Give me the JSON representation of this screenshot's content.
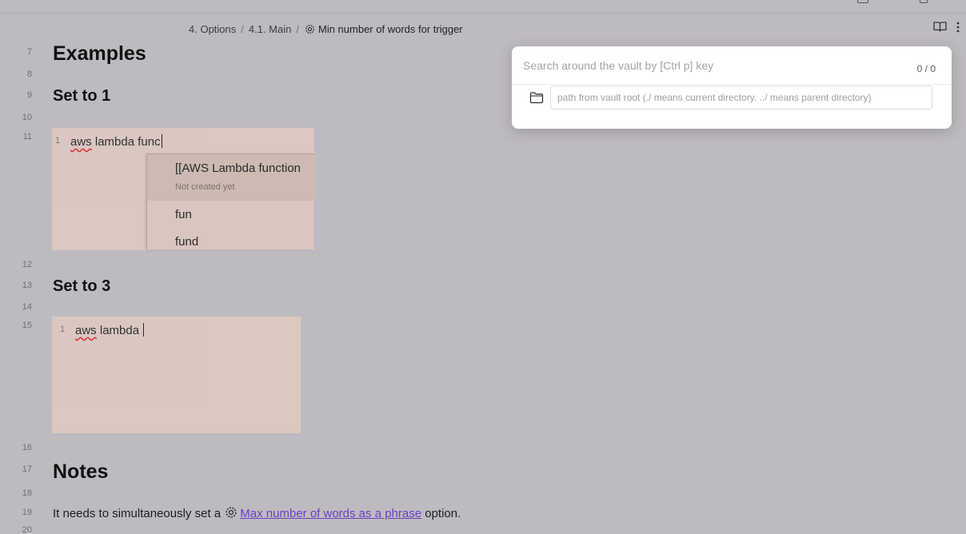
{
  "breadcrumb": {
    "items": [
      "4. Options",
      "4.1. Main"
    ],
    "current": "Min number of words for trigger",
    "separator": "/"
  },
  "view_actions": {
    "reading_view_icon": "book-open-icon",
    "more_options_icon": "more-vertical-icon"
  },
  "editor": {
    "line_numbers": {
      "l7": "7",
      "l8": "8",
      "l9": "9",
      "l10": "10",
      "l11": "11",
      "l12": "12",
      "l13": "13",
      "l14": "14",
      "l15": "15",
      "l16": "16",
      "l17": "17",
      "l18": "18",
      "l19": "19",
      "l20": "20"
    },
    "heading_examples": "Examples",
    "heading_set1": "Set to 1",
    "heading_set3": "Set to 3",
    "heading_notes": "Notes",
    "example1": {
      "line_number": "1",
      "word1": "aws",
      "rest": " lambda func"
    },
    "example2": {
      "line_number": "1",
      "word1": "aws",
      "rest": " lambda "
    },
    "suggestions": {
      "items": [
        {
          "label": "[[AWS Lambda function",
          "sublabel": "Not created yet"
        },
        {
          "label": "fun"
        },
        {
          "label": "fund"
        }
      ]
    },
    "notes_text": {
      "before": "It needs to simultaneously set a ",
      "link": "Max number of words as a phrase",
      "after": " option."
    }
  },
  "search_modal": {
    "search_placeholder": "Search around the vault by [Ctrl p] key",
    "search_value": "",
    "count": "0 / 0",
    "path_placeholder": "path from vault root (./ means current directory. ../ means parent directory)",
    "path_value": ""
  },
  "colors": {
    "backdrop": "#bebbc0",
    "code_block": "#dcc8c0",
    "link": "#6a3fc6",
    "modal_bg": "#ffffff"
  }
}
